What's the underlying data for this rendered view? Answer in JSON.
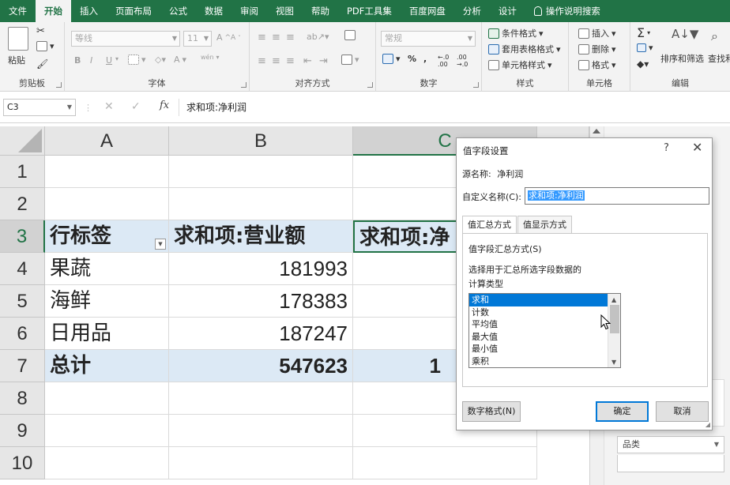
{
  "menu": [
    "文件",
    "开始",
    "插入",
    "页面布局",
    "公式",
    "数据",
    "审阅",
    "视图",
    "帮助",
    "PDF工具集",
    "百度网盘",
    "分析",
    "设计"
  ],
  "menu_active": "开始",
  "menu_help": "操作说明搜索",
  "ribbon": {
    "clipboard": {
      "label": "剪贴板",
      "paste": "粘贴"
    },
    "font": {
      "label": "字体",
      "font_name": "等线",
      "font_size": "11",
      "grow": "A",
      "shrink": "A",
      "bold": "B",
      "italic": "I",
      "underline": "U",
      "color_a": "A",
      "pinyin": "wén"
    },
    "align": {
      "label": "对齐方式"
    },
    "number": {
      "label": "数字",
      "format": "常规",
      "percent": "%",
      "comma": ",",
      "inc": "←.0 .00",
      "dec": ".00 →.0"
    },
    "styles": {
      "label": "样式",
      "cond": "条件格式",
      "table": "套用表格格式",
      "cell": "单元格样式"
    },
    "cells": {
      "label": "单元格",
      "insert": "插入",
      "delete": "删除",
      "format": "格式"
    },
    "editing": {
      "label": "编辑",
      "sum": "Σ",
      "sort": "排序和筛选",
      "find": "查找和"
    }
  },
  "formula_bar": {
    "name_box": "C3",
    "fx": "fx",
    "content": "求和项:净利润"
  },
  "sheet": {
    "columns": [
      "A",
      "B",
      "C"
    ],
    "rows": [
      "1",
      "2",
      "3",
      "4",
      "5",
      "6",
      "7",
      "8",
      "9",
      "10"
    ],
    "cells": {
      "A3": "行标签",
      "B3": "求和项:营业额",
      "C3": "求和项:净",
      "A4": "果蔬",
      "B4": "181993",
      "A5": "海鲜",
      "B5": "178383",
      "A6": "日用品",
      "B6": "187247",
      "A7": "总计",
      "B7": "547623",
      "C7": "1"
    }
  },
  "pane": {
    "field": "品类"
  },
  "dialog": {
    "title": "值字段设置",
    "help": "?",
    "close": "✕",
    "source_label": "源名称:",
    "source_value": "净利润",
    "custom_label": "自定义名称(C):",
    "custom_value": "求和项:净利润",
    "tabs": [
      "值汇总方式",
      "值显示方式"
    ],
    "tab_heading": "值字段汇总方式(S)",
    "desc1": "选择用于汇总所选字段数据的",
    "desc2": "计算类型",
    "list": [
      "求和",
      "计数",
      "平均值",
      "最大值",
      "最小值",
      "乘积"
    ],
    "number_format": "数字格式(N)",
    "ok": "确定",
    "cancel": "取消"
  },
  "colors": {
    "excel_green": "#217346",
    "pivot_header": "#dce9f5",
    "select_blue": "#0078d7"
  }
}
